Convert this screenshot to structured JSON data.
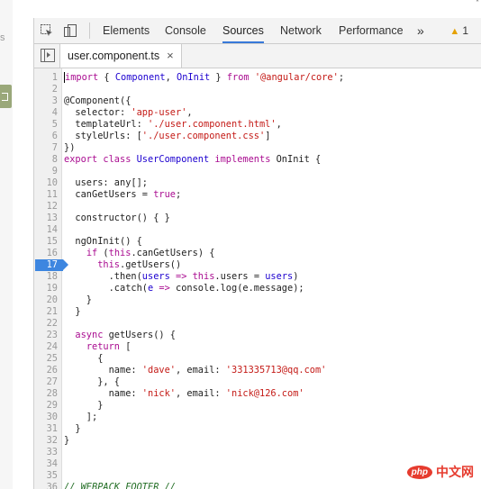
{
  "edge": {
    "left_letter": "s",
    "top_mark": "*"
  },
  "tabs": [
    {
      "label": "Elements"
    },
    {
      "label": "Console"
    },
    {
      "label": "Sources"
    },
    {
      "label": "Network"
    },
    {
      "label": "Performance"
    }
  ],
  "toolbar": {
    "more": "»",
    "warning_count": "1"
  },
  "file_tab": {
    "name": "user.component.ts",
    "close": "×"
  },
  "breakpoint_line": 17,
  "lines": [
    [
      [
        "kw",
        "import"
      ],
      [
        "def",
        " { "
      ],
      [
        "var",
        "Component"
      ],
      [
        "def",
        ", "
      ],
      [
        "var",
        "OnInit"
      ],
      [
        "def",
        " } "
      ],
      [
        "kw",
        "from"
      ],
      [
        "def",
        " "
      ],
      [
        "str",
        "'@angular/core'"
      ],
      [
        "def",
        ";"
      ]
    ],
    [],
    [
      [
        "def",
        "@Component({"
      ]
    ],
    [
      [
        "def",
        "  selector: "
      ],
      [
        "str",
        "'app-user'"
      ],
      [
        "def",
        ","
      ]
    ],
    [
      [
        "def",
        "  templateUrl: "
      ],
      [
        "str",
        "'./user.component.html'"
      ],
      [
        "def",
        ","
      ]
    ],
    [
      [
        "def",
        "  styleUrls: ["
      ],
      [
        "str",
        "'./user.component.css'"
      ],
      [
        "def",
        "]"
      ]
    ],
    [
      [
        "def",
        "})"
      ]
    ],
    [
      [
        "kw",
        "export"
      ],
      [
        "def",
        " "
      ],
      [
        "kw",
        "class"
      ],
      [
        "def",
        " "
      ],
      [
        "var",
        "UserComponent"
      ],
      [
        "def",
        " "
      ],
      [
        "kw",
        "implements"
      ],
      [
        "def",
        " OnInit {"
      ]
    ],
    [],
    [
      [
        "def",
        "  users: any[];"
      ]
    ],
    [
      [
        "def",
        "  canGetUsers = "
      ],
      [
        "kw",
        "true"
      ],
      [
        "def",
        ";"
      ]
    ],
    [],
    [
      [
        "def",
        "  constructor() { }"
      ]
    ],
    [],
    [
      [
        "def",
        "  ngOnInit() {"
      ]
    ],
    [
      [
        "def",
        "    "
      ],
      [
        "kw",
        "if"
      ],
      [
        "def",
        " ("
      ],
      [
        "kw",
        "this"
      ],
      [
        "def",
        ".canGetUsers) {"
      ]
    ],
    [
      [
        "def",
        "      "
      ],
      [
        "kw",
        "this"
      ],
      [
        "def",
        ".getUsers()"
      ]
    ],
    [
      [
        "def",
        "        .then("
      ],
      [
        "var",
        "users"
      ],
      [
        "def",
        " "
      ],
      [
        "kw",
        "=>"
      ],
      [
        "def",
        " "
      ],
      [
        "kw",
        "this"
      ],
      [
        "def",
        ".users = "
      ],
      [
        "var",
        "users"
      ],
      [
        "def",
        ")"
      ]
    ],
    [
      [
        "def",
        "        .catch("
      ],
      [
        "var",
        "e"
      ],
      [
        "def",
        " "
      ],
      [
        "kw",
        "=>"
      ],
      [
        "def",
        " console.log(e.message);"
      ]
    ],
    [
      [
        "def",
        "    }"
      ]
    ],
    [
      [
        "def",
        "  }"
      ]
    ],
    [],
    [
      [
        "def",
        "  "
      ],
      [
        "kw",
        "async"
      ],
      [
        "def",
        " getUsers() {"
      ]
    ],
    [
      [
        "def",
        "    "
      ],
      [
        "kw",
        "return"
      ],
      [
        "def",
        " ["
      ]
    ],
    [
      [
        "def",
        "      {"
      ]
    ],
    [
      [
        "def",
        "        name: "
      ],
      [
        "str",
        "'dave'"
      ],
      [
        "def",
        ", email: "
      ],
      [
        "str",
        "'331335713@qq.com'"
      ]
    ],
    [
      [
        "def",
        "      }, {"
      ]
    ],
    [
      [
        "def",
        "        name: "
      ],
      [
        "str",
        "'nick'"
      ],
      [
        "def",
        ", email: "
      ],
      [
        "str",
        "'nick@126.com'"
      ]
    ],
    [
      [
        "def",
        "      }"
      ]
    ],
    [
      [
        "def",
        "    ];"
      ]
    ],
    [
      [
        "def",
        "  }"
      ]
    ],
    [
      [
        "def",
        "}"
      ]
    ],
    [],
    [],
    [],
    [
      [
        "cmt",
        "// WEBPACK FOOTER //"
      ]
    ]
  ],
  "watermark": {
    "logo": "php",
    "text": "中文网"
  }
}
